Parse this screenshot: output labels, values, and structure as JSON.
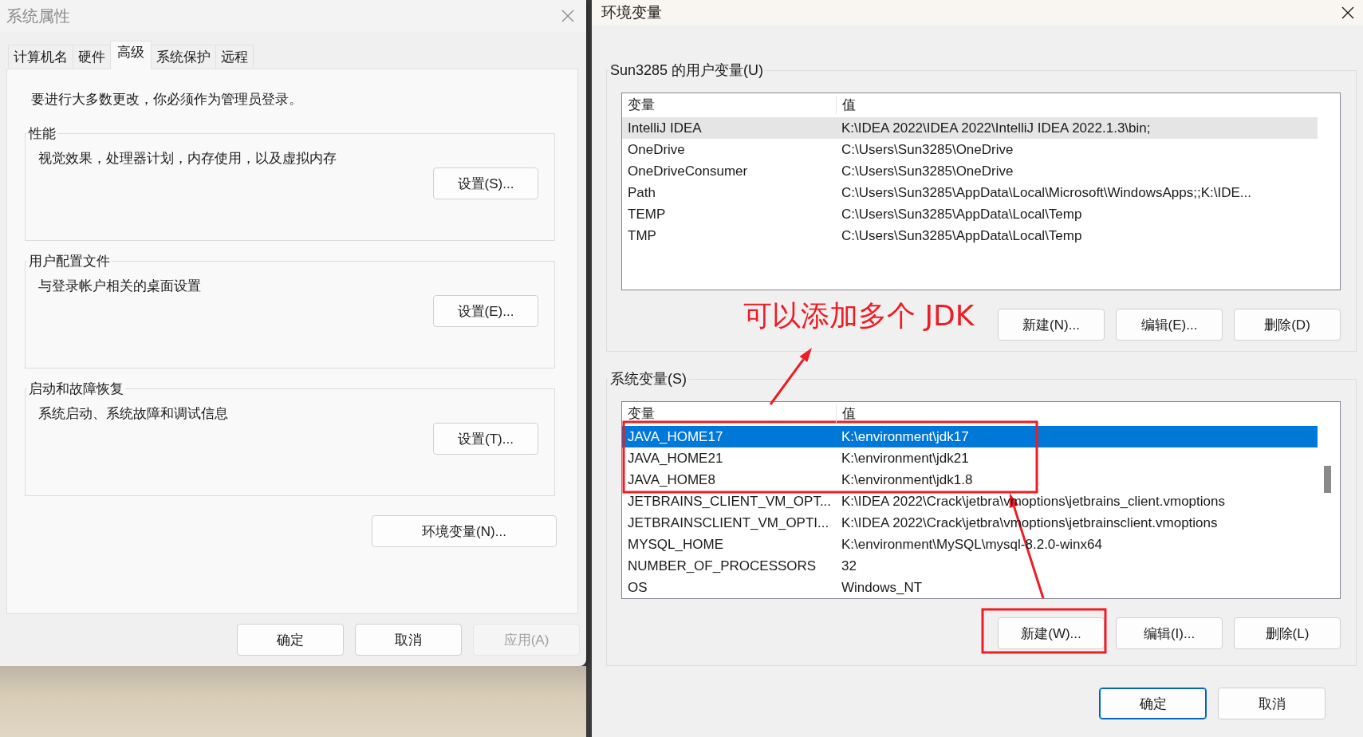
{
  "system_properties": {
    "title": "系统属性",
    "tabs": [
      {
        "label": "计算机名",
        "selected": false
      },
      {
        "label": "硬件",
        "selected": false
      },
      {
        "label": "高级",
        "selected": true
      },
      {
        "label": "系统保护",
        "selected": false
      },
      {
        "label": "远程",
        "selected": false
      }
    ],
    "notice": "要进行大多数更改，你必须作为管理员登录。",
    "groups": [
      {
        "title": "性能",
        "description": "视觉效果，处理器计划，内存使用，以及虚拟内存",
        "button": "设置(S)..."
      },
      {
        "title": "用户配置文件",
        "description": "与登录帐户相关的桌面设置",
        "button": "设置(E)..."
      },
      {
        "title": "启动和故障恢复",
        "description": "系统启动、系统故障和调试信息",
        "button": "设置(T)..."
      }
    ],
    "env_button": "环境变量(N)...",
    "buttons": [
      {
        "label": "确定",
        "disabled": false
      },
      {
        "label": "取消",
        "disabled": false
      },
      {
        "label": "应用(A)",
        "disabled": true
      }
    ]
  },
  "environment_variables": {
    "title": "环境变量",
    "user_vars": {
      "title": "Sun3285 的用户变量(U)",
      "columns": [
        "变量",
        "值"
      ],
      "focused": false,
      "rows": [
        {
          "name": "IntelliJ IDEA",
          "value": "K:\\IDEA 2022\\IDEA 2022\\IntelliJ IDEA 2022.1.3\\bin;",
          "selected": true
        },
        {
          "name": "OneDrive",
          "value": "C:\\Users\\Sun3285\\OneDrive",
          "selected": false
        },
        {
          "name": "OneDriveConsumer",
          "value": "C:\\Users\\Sun3285\\OneDrive",
          "selected": false
        },
        {
          "name": "Path",
          "value": "C:\\Users\\Sun3285\\AppData\\Local\\Microsoft\\WindowsApps;;K:\\IDE...",
          "selected": false
        },
        {
          "name": "TEMP",
          "value": "C:\\Users\\Sun3285\\AppData\\Local\\Temp",
          "selected": false
        },
        {
          "name": "TMP",
          "value": "C:\\Users\\Sun3285\\AppData\\Local\\Temp",
          "selected": false
        }
      ],
      "buttons": [
        "新建(N)...",
        "编辑(E)...",
        "删除(D)"
      ]
    },
    "system_vars": {
      "title": "系统变量(S)",
      "columns": [
        "变量",
        "值"
      ],
      "focused": true,
      "rows": [
        {
          "name": "JAVA_HOME17",
          "value": "K:\\environment\\jdk17",
          "selected": true
        },
        {
          "name": "JAVA_HOME21",
          "value": "K:\\environment\\jdk21",
          "selected": false
        },
        {
          "name": "JAVA_HOME8",
          "value": "K:\\environment\\jdk1.8",
          "selected": false
        },
        {
          "name": "JETBRAINS_CLIENT_VM_OPT...",
          "value": "K:\\IDEA 2022\\Crack\\jetbra\\vmoptions\\jetbrains_client.vmoptions",
          "selected": false
        },
        {
          "name": "JETBRAINSCLIENT_VM_OPTI...",
          "value": "K:\\IDEA 2022\\Crack\\jetbra\\vmoptions\\jetbrainsclient.vmoptions",
          "selected": false
        },
        {
          "name": "MYSQL_HOME",
          "value": "K:\\environment\\MySQL\\mysql-8.2.0-winx64",
          "selected": false
        },
        {
          "name": "NUMBER_OF_PROCESSORS",
          "value": "32",
          "selected": false
        },
        {
          "name": "OS",
          "value": "Windows_NT",
          "selected": false
        }
      ],
      "buttons": [
        "新建(W)...",
        "编辑(I)...",
        "删除(L)"
      ]
    },
    "buttons": [
      {
        "label": "确定",
        "default": true
      },
      {
        "label": "取消",
        "default": false
      }
    ]
  },
  "annotation": {
    "text": "可以添加多个 JDK"
  }
}
